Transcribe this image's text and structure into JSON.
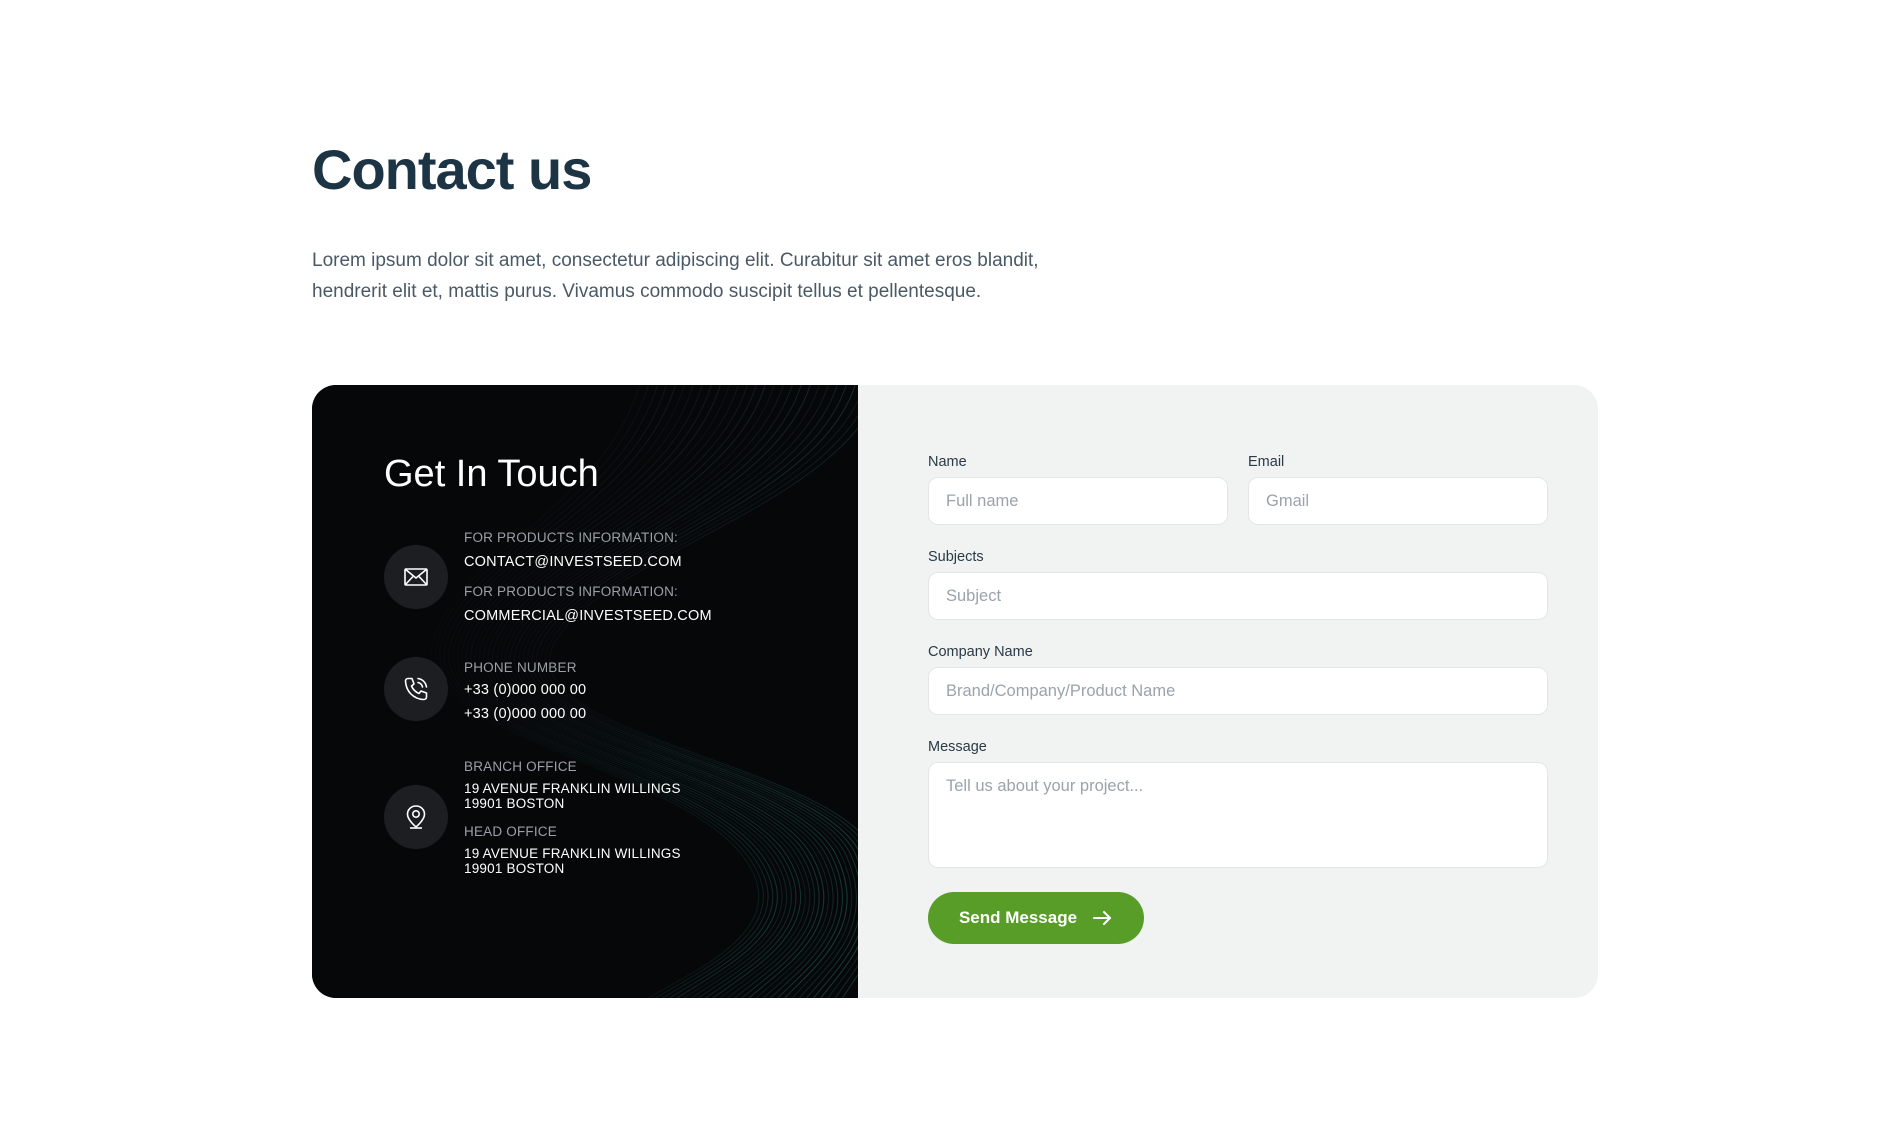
{
  "header": {
    "title": "Contact us",
    "intro": "Lorem ipsum dolor sit amet, consectetur adipiscing elit. Curabitur sit amet eros blandit, hendrerit elit et, mattis purus. Vivamus commodo suscipit tellus et pellentesque."
  },
  "contact_panel": {
    "title": "Get In Touch",
    "email_block": {
      "icon": "envelope-icon",
      "label_1": "FOR PRODUCTS INFORMATION:",
      "value_1": "CONTACT@INVESTSEED.COM",
      "label_2": "FOR PRODUCTS INFORMATION:",
      "value_2": "COMMERCIAL@INVESTSEED.COM"
    },
    "phone_block": {
      "icon": "phone-icon",
      "label": "PHONE NUMBER",
      "value_1": "+33 (0)000 000 00",
      "value_2": "+33 (0)000 000 00"
    },
    "address_block": {
      "icon": "map-pin-icon",
      "branch_label": "BRANCH OFFICE",
      "branch_line_1": "19 AVENUE FRANKLIN WILLINGS",
      "branch_line_2": "19901 BOSTON",
      "head_label": "HEAD OFFICE",
      "head_line_1": "19 AVENUE FRANKLIN WILLINGS",
      "head_line_2": "19901 BOSTON"
    }
  },
  "form": {
    "name": {
      "label": "Name",
      "placeholder": "Full name"
    },
    "email": {
      "label": "Email",
      "placeholder": "Gmail"
    },
    "subject": {
      "label": "Subjects",
      "placeholder": "Subject"
    },
    "company": {
      "label": "Company Name",
      "placeholder": "Brand/Company/Product Name"
    },
    "message": {
      "label": "Message",
      "placeholder": "Tell us about your project..."
    },
    "submit_label": "Send Message",
    "submit_icon": "arrow-right-icon"
  },
  "colors": {
    "heading": "#1d3444",
    "accent": "#589d28",
    "panel_dark": "#060708",
    "form_bg": "#f1f2f2"
  }
}
